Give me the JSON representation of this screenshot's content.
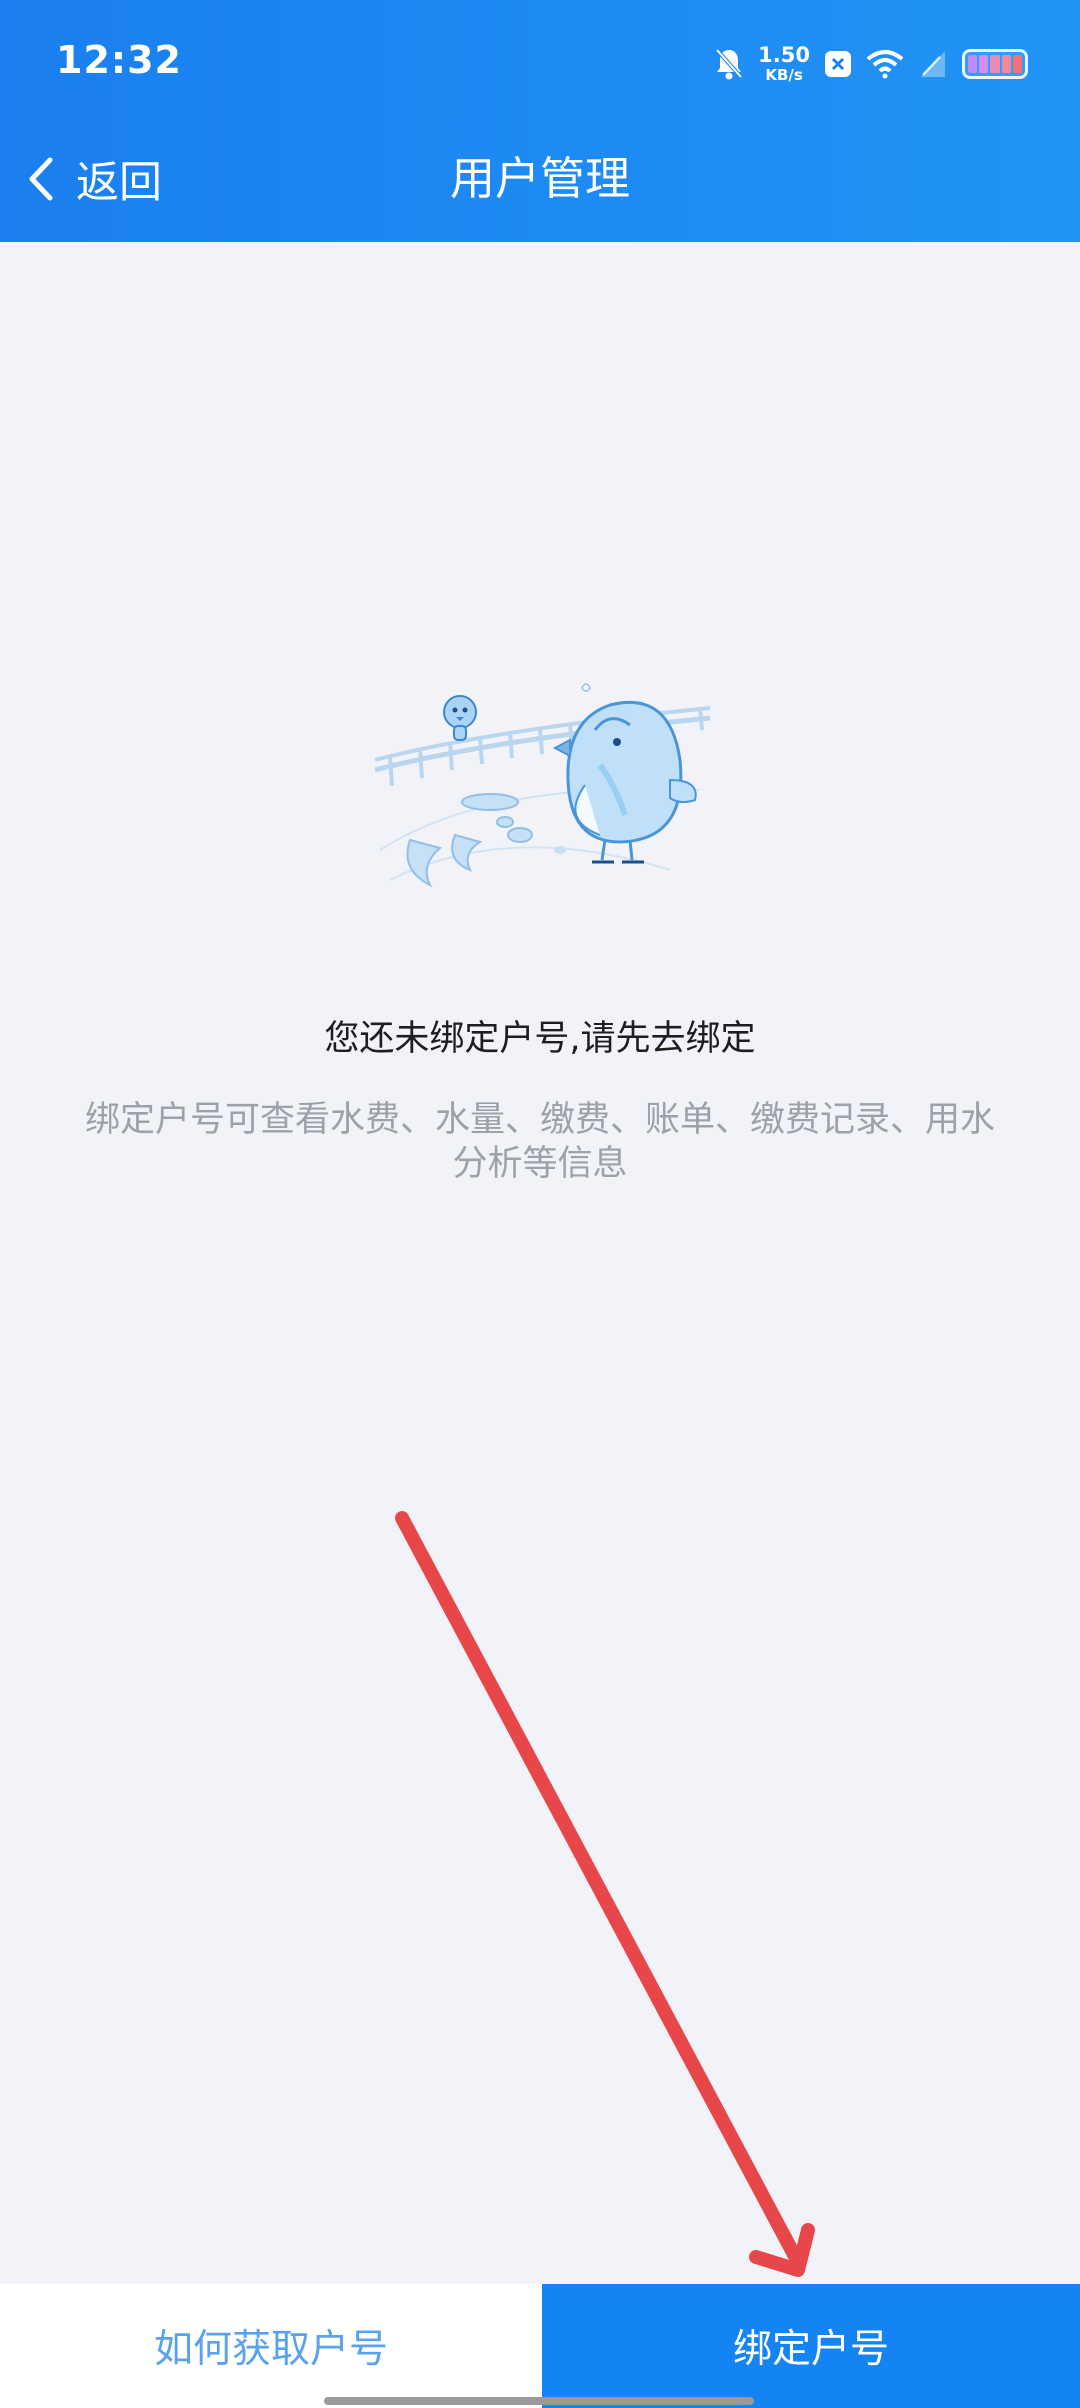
{
  "status_bar": {
    "time": "12:32",
    "net_speed_value": "1.50",
    "net_speed_unit": "KB/s",
    "icons": [
      "bell-off-icon",
      "close-badge-icon",
      "wifi-icon",
      "signal-icon",
      "battery-icon"
    ]
  },
  "nav": {
    "back_label": "返回",
    "title": "用户管理"
  },
  "empty_state": {
    "title": "您还未绑定户号,请先去绑定",
    "description_line1": "绑定户号可查看水费、水量、缴费、账单、缴费记录、用水",
    "description_line2": "分析等信息"
  },
  "bottom_bar": {
    "how_to_get_label": "如何获取户号",
    "bind_label": "绑定户号"
  },
  "colors": {
    "header_blue": "#1a7ff0",
    "bind_button_blue": "#1483f3",
    "link_blue": "#5aa3ec",
    "background": "#f2f3f8",
    "annotation_red": "#e8474a"
  }
}
